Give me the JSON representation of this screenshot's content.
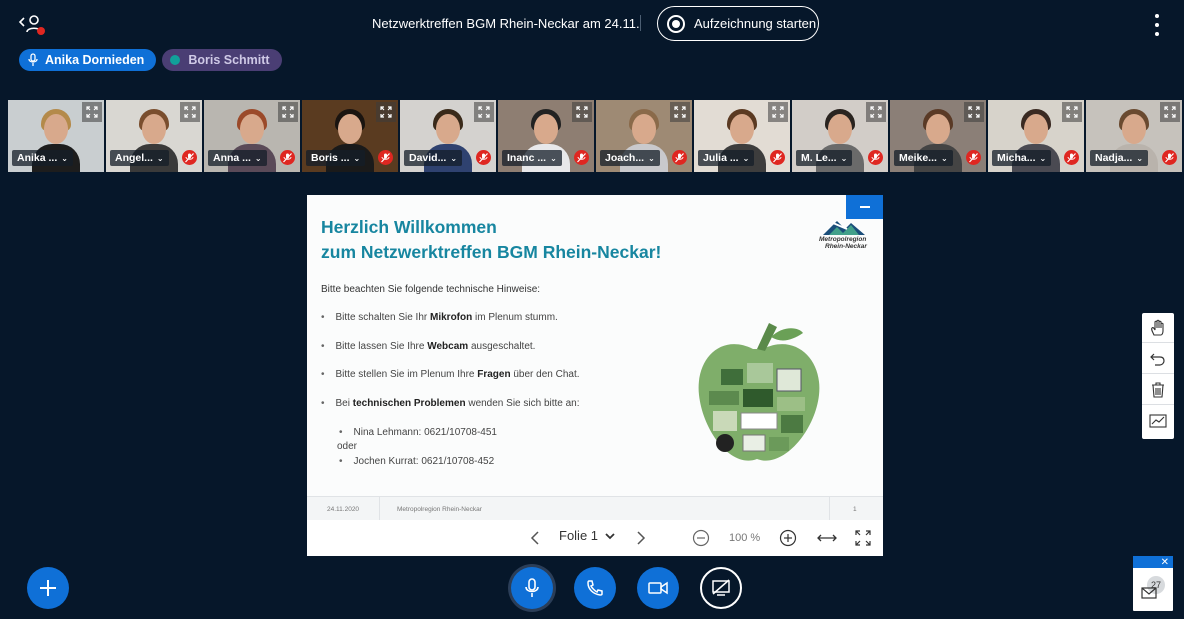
{
  "topbar": {
    "meeting_title": "Netzwerktreffen BGM Rhein-Neckar am 24.11.",
    "record_label": "Aufzeichnung starten"
  },
  "talkers": [
    {
      "name": "Anika Dornieden",
      "state": "active"
    },
    {
      "name": "Boris Schmitt",
      "state": "muted"
    }
  ],
  "videos": [
    {
      "label": "Anika ...",
      "muted": false,
      "bg": "#c9ced0",
      "hair": "#b48a4a",
      "shirt": "#1d1d1d"
    },
    {
      "label": "Angel...",
      "muted": true,
      "bg": "#d9d7d2",
      "hair": "#7a4e2e",
      "shirt": "#3a3a3a"
    },
    {
      "label": "Anna ...",
      "muted": true,
      "bg": "#b9b6b0",
      "hair": "#9b4a2a",
      "shirt": "#5a4a58"
    },
    {
      "label": "Boris ...",
      "muted": true,
      "bg": "#5a3b20",
      "hair": "#1a1410",
      "shirt": "#1a1a1a"
    },
    {
      "label": "David...",
      "muted": true,
      "bg": "#d4d2cf",
      "hair": "#3a2a1a",
      "shirt": "#2f4270"
    },
    {
      "label": "Inanc ...",
      "muted": true,
      "bg": "#8e7e72",
      "hair": "#222222",
      "shirt": "#e8e8ea"
    },
    {
      "label": "Joach...",
      "muted": true,
      "bg": "#9e8a74",
      "hair": "#8a6a4a",
      "shirt": "#c9c9cc"
    },
    {
      "label": "Julia ...",
      "muted": true,
      "bg": "#e2dcd4",
      "hair": "#5b3a22",
      "shirt": "#3d3d3d"
    },
    {
      "label": "M. Le...",
      "muted": true,
      "bg": "#d2cdc8",
      "hair": "#2a2420",
      "shirt": "#6a6a6a"
    },
    {
      "label": "Meike...",
      "muted": true,
      "bg": "#8b7f77",
      "hair": "#5a3a26",
      "shirt": "#444444"
    },
    {
      "label": "Micha...",
      "muted": true,
      "bg": "#d7d3cb",
      "hair": "#3a2a22",
      "shirt": "#4a4a52"
    },
    {
      "label": "Nadja...",
      "muted": true,
      "bg": "#c6c2bc",
      "hair": "#6a4a30",
      "shirt": "#b9b3ac"
    }
  ],
  "slide": {
    "title_line1": "Herzlich Willkommen",
    "title_line2": "zum Netzwerktreffen BGM Rhein-Neckar!",
    "logo_line1": "Metropolregion",
    "logo_line2": "Rhein-Neckar",
    "intro": "Bitte beachten Sie folgende technische Hinweise:",
    "b1_pre": "Bitte schalten Sie Ihr ",
    "b1_bold": "Mikrofon",
    "b1_post": " im Plenum stumm.",
    "b2_pre": "Bitte lassen Sie Ihre ",
    "b2_bold": "Webcam",
    "b2_post": " ausgeschaltet.",
    "b3_pre": "Bitte stellen Sie im Plenum Ihre ",
    "b3_bold": "Fragen",
    "b3_post": " über den Chat.",
    "b4_pre": "Bei ",
    "b4_bold": "technischen Problemen",
    "b4_post": " wenden Sie sich bitte an:",
    "contact1": "Nina Lehmann: 0621/10708-451",
    "oder": "oder",
    "contact2": "Jochen Kurrat: 0621/10708-452",
    "footer_date": "24.11.2020",
    "footer_org": "Metropolregion Rhein-Neckar",
    "footer_page": "1"
  },
  "pres_toolbar": {
    "slide_label": "Folie 1",
    "zoom": "100 %"
  },
  "chat": {
    "count": "27"
  },
  "colors": {
    "primary": "#0f70d7",
    "background": "#06172a",
    "danger": "#df2721",
    "slide_title": "#1786a0"
  }
}
